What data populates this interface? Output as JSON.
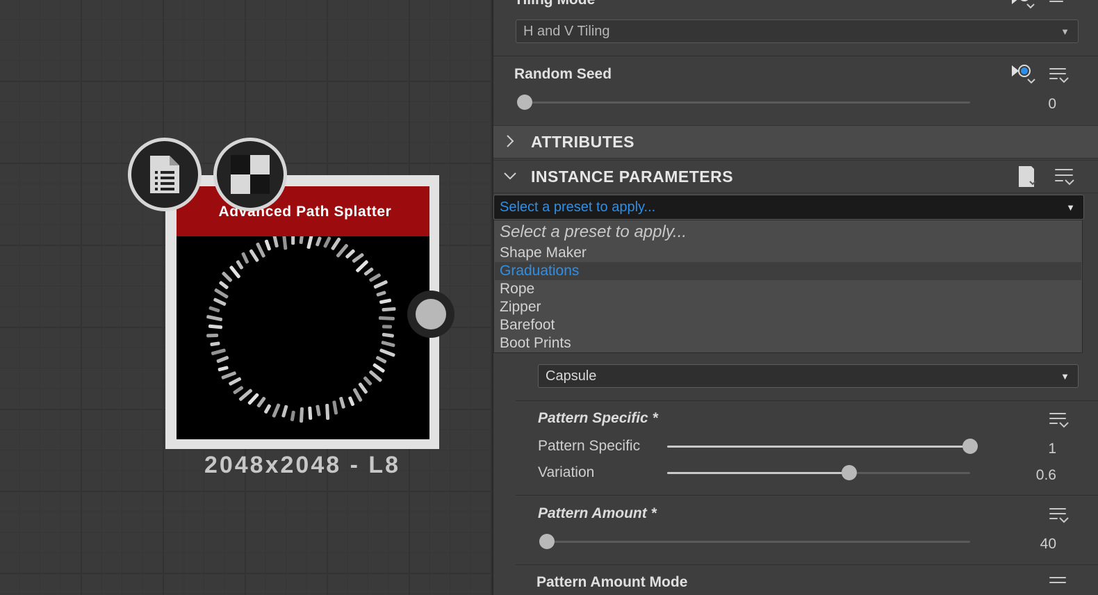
{
  "node": {
    "title": "Advanced Path Splatter",
    "resolution": "2048x2048 - L8",
    "icons": [
      "document-list-icon",
      "checkerboard-icon"
    ],
    "title_color": "#9c0b0d"
  },
  "panel": {
    "tiling": {
      "label": "Tiling Mode",
      "value": "H and V Tiling"
    },
    "random_seed": {
      "label": "Random Seed",
      "value": "0",
      "slider_fraction": 0
    },
    "attributes": {
      "title": "ATTRIBUTES",
      "expanded": false
    },
    "instance_parameters": {
      "title": "INSTANCE PARAMETERS",
      "expanded": true
    },
    "preset": {
      "placeholder": "Select a preset to apply...",
      "options": [
        "Select a preset to apply...",
        "Shape Maker",
        "Graduations",
        "Rope",
        "Zipper",
        "Barefoot",
        "Boot Prints"
      ],
      "highlighted": "Graduations"
    },
    "shape": {
      "value": "Capsule"
    },
    "pattern_specific_group": {
      "title": "Pattern Specific *",
      "params": [
        {
          "label": "Pattern Specific",
          "value": "1",
          "slider_fraction": 1.0
        },
        {
          "label": "Variation",
          "value": "0.6",
          "slider_fraction": 0.6
        }
      ]
    },
    "pattern_amount_group": {
      "title": "Pattern Amount *",
      "value": "40",
      "slider_fraction": 0
    },
    "pattern_amount_mode": {
      "label": "Pattern Amount Mode"
    }
  },
  "colors": {
    "accent_blue": "#2d8fe8",
    "node_red": "#9c0b0d"
  }
}
